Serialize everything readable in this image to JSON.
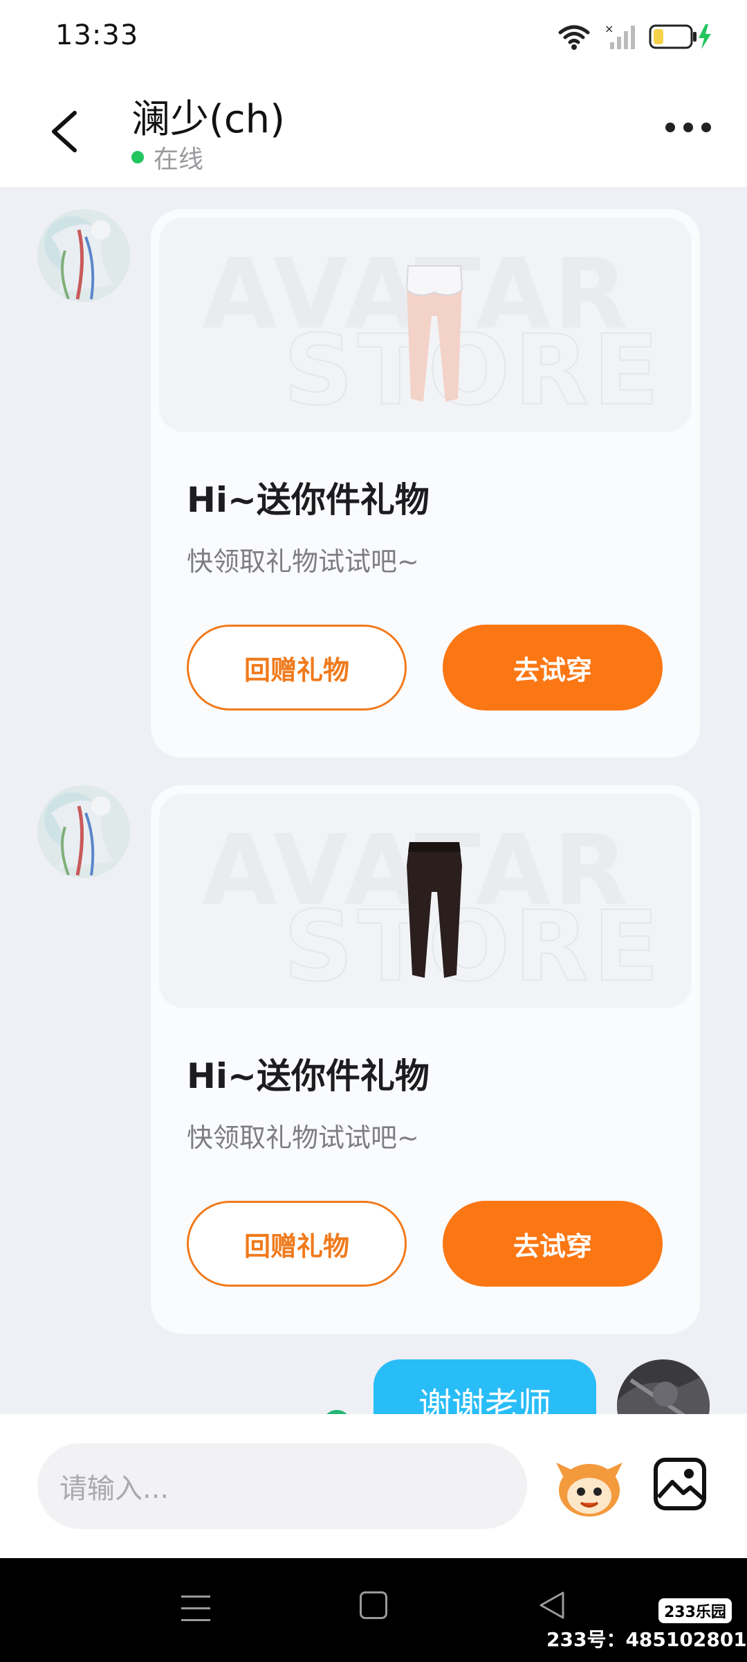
{
  "status_bar": {
    "time": "13:33",
    "battery_color": "#f5d24a",
    "charging_color": "#22c55e"
  },
  "header": {
    "title": "澜少(ch)",
    "status": "在线",
    "back_icon": "chevron-left-icon",
    "more_icon": "more-dots-icon"
  },
  "messages": [
    {
      "title": "Hi~送你件礼物",
      "subtitle": "快领取礼物试试吧~",
      "btn_return": "回赠礼物",
      "btn_try": "去试穿",
      "item": "white-shorts"
    },
    {
      "title": "Hi~送你件礼物",
      "subtitle": "快领取礼物试试吧~",
      "btn_return": "回赠礼物",
      "btn_try": "去试穿",
      "item": "black-tights"
    }
  ],
  "sent_message": {
    "text": "谢谢老师"
  },
  "input": {
    "placeholder": "请输入..."
  },
  "watermark": {
    "brand": "233乐园",
    "id_text": "233号：485102801"
  },
  "colors": {
    "accent_orange": "#fb7714",
    "bubble_blue": "#29bdf7",
    "chat_bg": "#eef0f5"
  }
}
